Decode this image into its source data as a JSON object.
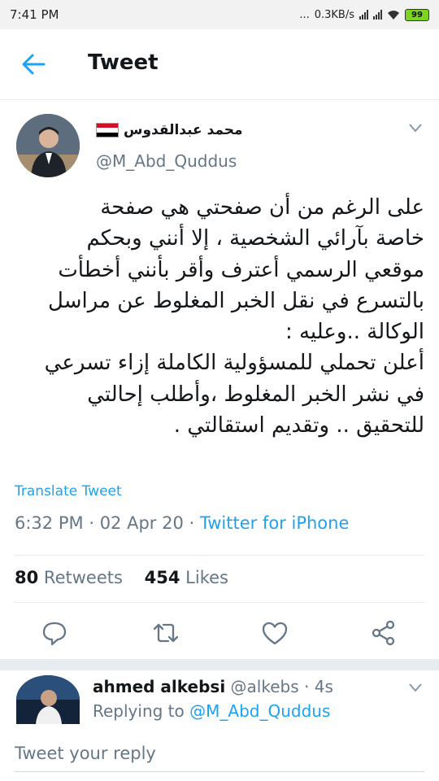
{
  "status_bar": {
    "time": "7:41 PM",
    "dots": "...",
    "speed": "0.3KB/s",
    "battery": "99"
  },
  "header": {
    "title": "Tweet"
  },
  "tweet": {
    "author_name": "محمد عبدالقدوس",
    "handle": "@M_Abd_Quddus",
    "text": "على الرغم من أن صفحتي هي صفحة\nخاصة بآرائي الشخصية ، إلا أنني وبحكم\nموقعي الرسمي أعترف وأقر بأنني أخطأت\nبالتسرع في نقل الخبر المغلوط عن مراسل\nالوكالة ..وعليه :\nأعلن تحملي للمسؤولية الكاملة إزاء تسرعي\nفي نشر الخبر المغلوط ،وأطلب إحالتي\nللتحقيق .. وتقديم استقالتي .",
    "translate_label": "Translate Tweet",
    "time": "6:32 PM",
    "dot1": "·",
    "date": "02 Apr 20",
    "dot2": "·",
    "source": "Twitter for iPhone",
    "retweets_count": "80",
    "retweets_label": "Retweets",
    "likes_count": "454",
    "likes_label": "Likes"
  },
  "reply": {
    "name": "ahmed alkebsi",
    "handle": "@alkebs",
    "dot": "·",
    "age": "4s",
    "replying_label": "Replying to",
    "replying_to": "@M_Abd_Quddus"
  },
  "composer": {
    "placeholder": "Tweet your reply"
  },
  "colors": {
    "accent": "#1da1f2",
    "secondary_text": "#657786",
    "primary_text": "#14171a"
  },
  "icons": [
    "back-arrow-icon",
    "chevron-down-icon",
    "reply-icon",
    "retweet-icon",
    "like-icon",
    "share-icon",
    "wifi-icon",
    "signal-icon",
    "battery-icon",
    "egypt-flag-icon"
  ]
}
